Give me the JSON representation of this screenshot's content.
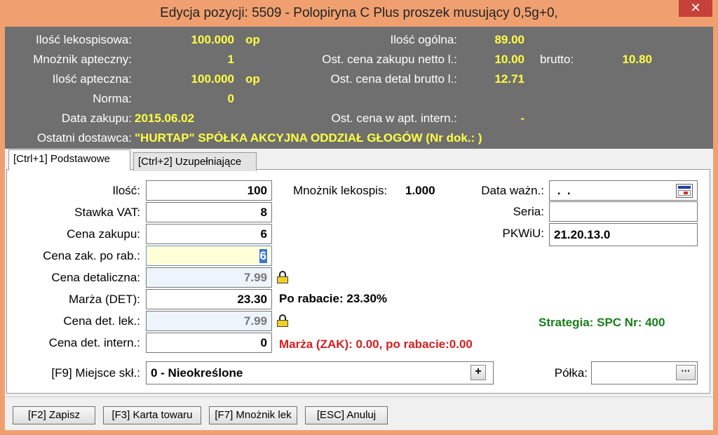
{
  "window": {
    "title": "Edycja pozycji: 5509 - Polopiryna C Plus proszek musujący 0,5g+0,",
    "close_glyph": "✕"
  },
  "info": {
    "ilosc_lekospisowa": {
      "label": "Ilość lekospisowa:",
      "value": "100.000",
      "unit": "op"
    },
    "mnoznik_apteczny": {
      "label": "Mnożnik apteczny:",
      "value": "1"
    },
    "ilosc_apteczna": {
      "label": "Ilość apteczna:",
      "value": "100.000",
      "unit": "op"
    },
    "norma": {
      "label": "Norma:",
      "value": "0"
    },
    "data_zakupu": {
      "label": "Data zakupu:",
      "value": "2015.06.02"
    },
    "ostatni_dostawca": {
      "label": "Ostatni dostawca:",
      "value": "\"HURTAP\" SPÓŁKA AKCYJNA ODDZIAŁ GŁOGÓW   (Nr dok.: )"
    },
    "ilosc_ogolna": {
      "label": "Ilość ogólna:",
      "value": "89.00"
    },
    "ost_cena_zakupu": {
      "label": "Ost. cena zakupu netto l.:",
      "value": "10.00",
      "brutto_label": "brutto:",
      "brutto_value": "10.80"
    },
    "ost_cena_detal": {
      "label": "Ost. cena detal brutto l.:",
      "value": "12.71"
    },
    "ost_cena_apt": {
      "label": "Ost. cena w apt. intern.:",
      "value": "-"
    }
  },
  "tabs": [
    {
      "label": "[Ctrl+1] Podstawowe",
      "active": true
    },
    {
      "label": "[Ctrl+2] Uzupełniające",
      "active": false
    }
  ],
  "form": {
    "ilosc": {
      "label": "Ilość:",
      "value": "100"
    },
    "stawka_vat": {
      "label": "Stawka VAT:",
      "value": "8"
    },
    "cena_zakupu": {
      "label": "Cena zakupu:",
      "value": "6"
    },
    "cena_zak_po_rab": {
      "label": "Cena zak. po rab.:",
      "value": "6"
    },
    "cena_detaliczna": {
      "label": "Cena detaliczna:",
      "value": "7.99"
    },
    "marza_det": {
      "label": "Marża (DET):",
      "value": "23.30"
    },
    "cena_det_lek": {
      "label": "Cena det. lek.:",
      "value": "7.99"
    },
    "cena_det_intern": {
      "label": "Cena det. intern.:",
      "value": "0"
    },
    "mnoznik_lekospis": {
      "label": "Mnożnik lekospis:",
      "value": "1.000"
    },
    "data_wazn": {
      "label": "Data ważn.:",
      "value": " .  ."
    },
    "seria": {
      "label": "Seria:",
      "value": ""
    },
    "pkwiu": {
      "label": "PKWiU:",
      "value": "21.20.13.0"
    },
    "po_rabacie": "Po rabacie: 23.30%",
    "strategia": "Strategia: SPC Nr: 400",
    "marza_zak": "Marża (ZAK): 0.00, po rabacie:0.00",
    "miejsce_skl": {
      "label": "[F9] Miejsce skł.:",
      "value": "0 - Nieokreślone",
      "button_glyph": "+"
    },
    "polka": {
      "label": "Półka:",
      "value": "",
      "button_glyph": "···"
    }
  },
  "buttons": [
    {
      "label": "[F2] Zapisz"
    },
    {
      "label": "[F3] Karta towaru"
    },
    {
      "label": "[F7] Mnożnik lek"
    },
    {
      "label": "[ESC] Anuluj"
    }
  ],
  "colors": {
    "frame": "#f0a070",
    "header_panel": "#6f6f6f",
    "header_value": "#ffff44",
    "strategy_green": "#1a7d1a",
    "margin_red": "#d42020",
    "close_red": "#c6413a"
  }
}
